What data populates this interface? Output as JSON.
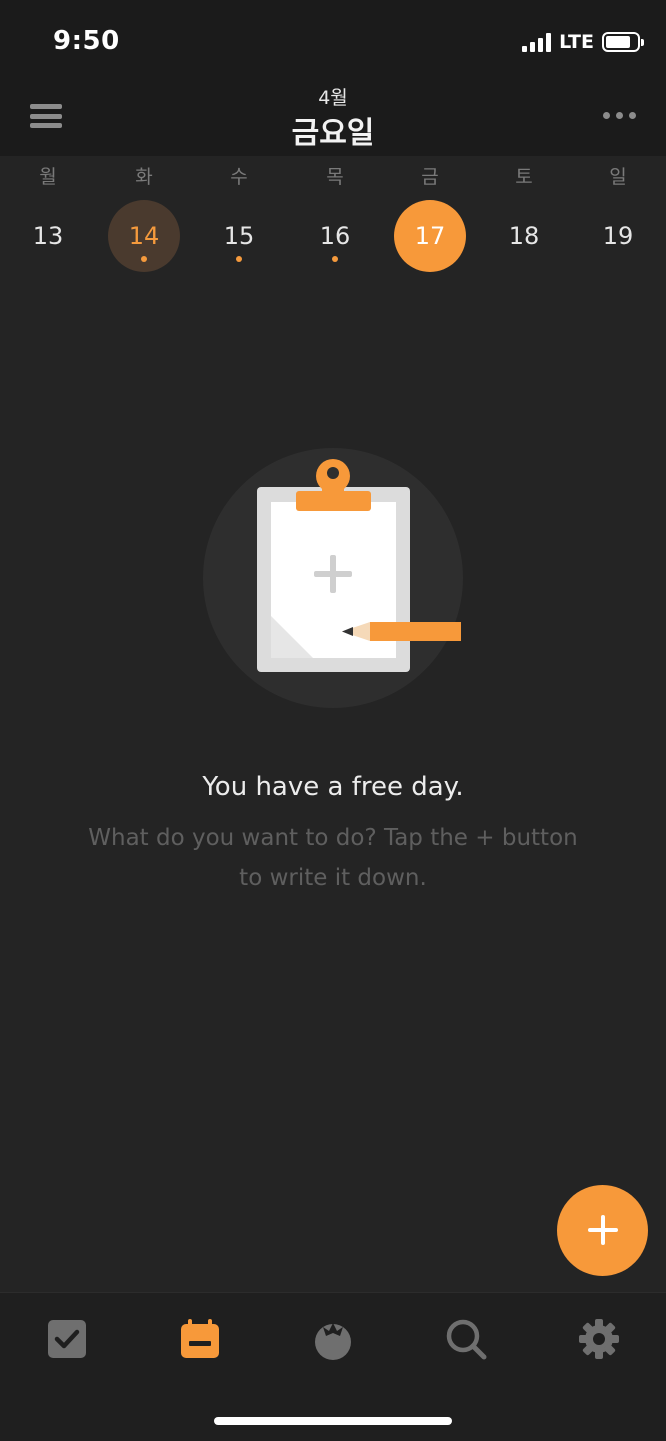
{
  "status_bar": {
    "time": "9:50",
    "network": "LTE"
  },
  "header": {
    "month": "4월",
    "day_title": "금요일"
  },
  "week": {
    "weekdays": [
      "월",
      "화",
      "수",
      "목",
      "금",
      "토",
      "일"
    ],
    "dates": [
      "13",
      "14",
      "15",
      "16",
      "17",
      "18",
      "19"
    ],
    "selected_index": 4,
    "highlighted_index": 1,
    "dot_indices": [
      1,
      2,
      3
    ]
  },
  "empty_state": {
    "title": "You have a free day.",
    "subtitle": "What do you want to do? Tap the + button to write it down."
  },
  "tabs": [
    {
      "name": "tasks",
      "icon": "checkbox-icon",
      "active": false
    },
    {
      "name": "calendar",
      "icon": "calendar-icon",
      "active": true
    },
    {
      "name": "pomodoro",
      "icon": "tomato-icon",
      "active": false
    },
    {
      "name": "search",
      "icon": "search-icon",
      "active": false
    },
    {
      "name": "settings",
      "icon": "gear-icon",
      "active": false
    }
  ],
  "colors": {
    "accent": "#f7993a",
    "background": "#242424",
    "header_bg": "#1b1b1b",
    "inactive_icon": "#6f6f6f"
  }
}
